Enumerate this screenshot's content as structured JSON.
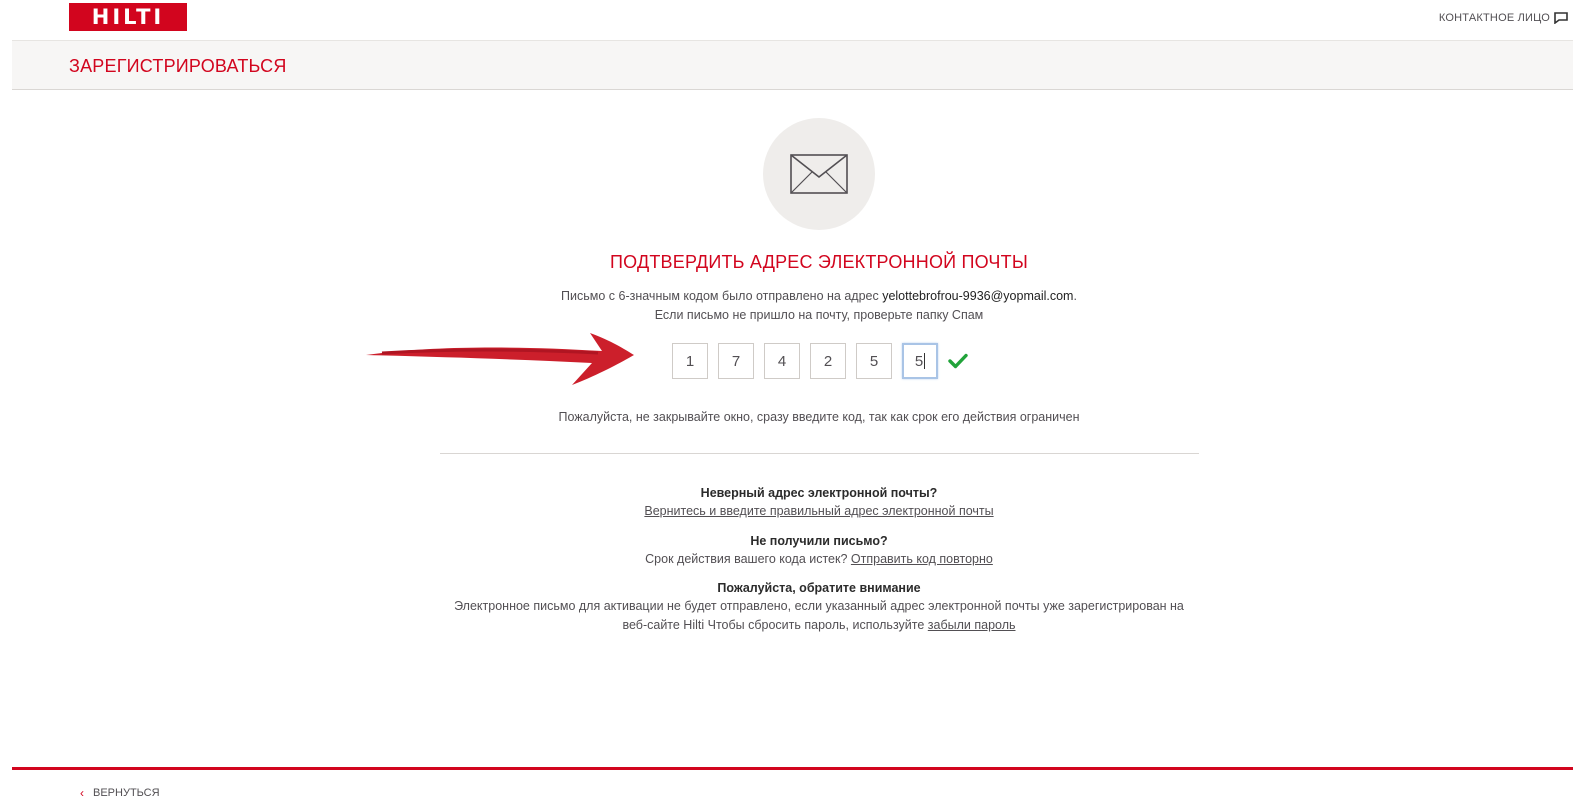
{
  "header": {
    "logo_text": "HILTI",
    "contact_label": "КОНТАКТНОЕ ЛИЦО",
    "contact_icon": "chat-icon"
  },
  "register": {
    "title": "ЗАРЕГИСТРИРОВАТЬСЯ"
  },
  "verify": {
    "icon": "envelope-icon",
    "heading": "ПОДТВЕРДИТЬ АДРЕС ЭЛЕКТРОННОЙ ПОЧТЫ",
    "sent_prefix": "Письмо с 6-значным кодом было отправлено на адрес ",
    "email": "yelottebrofrou-9936@yopmail.com",
    "sent_suffix": ".",
    "spam_hint": "Если письмо не пришло на почту, проверьте папку Спам",
    "code_digits": [
      "1",
      "7",
      "4",
      "2",
      "5",
      "5"
    ],
    "valid_icon": "checkmark-icon",
    "warning": "Пожалуйста, не закрывайте окно, сразу введите код, так как срок его действия ограничен"
  },
  "info": {
    "wrong_email_title": "Неверный адрес электронной почты?",
    "wrong_email_link": "Вернитесь и введите правильный адрес электронной почты",
    "no_email_title": "Не получили письмо?",
    "no_email_text": "Срок действия вашего кода истек? ",
    "resend_link": "Отправить код повторно",
    "notice_title": "Пожалуйста, обратите внимание",
    "notice_line1": "Электронное письмо для активации не будет отправлено, если указанный адрес электронной почты уже зарегистрирован на",
    "notice_line2_prefix": "веб-сайте Hilti Чтобы сбросить пароль, используйте ",
    "forgot_link": "забыли пароль"
  },
  "footer": {
    "back_label": "ВЕРНУТЬСЯ",
    "back_icon": "chevron-left-icon"
  },
  "colors": {
    "brand_red": "#d2051e",
    "success_green": "#21a33a"
  }
}
